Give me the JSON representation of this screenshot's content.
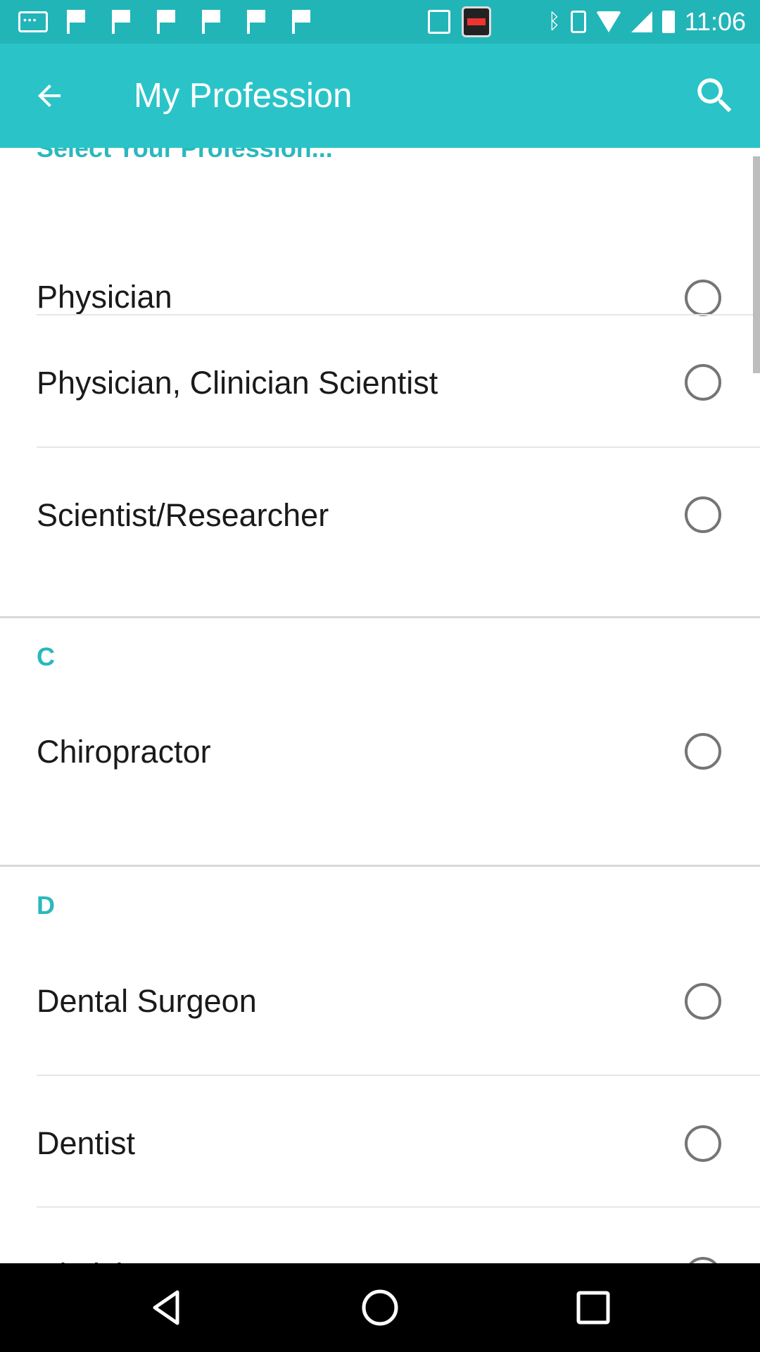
{
  "status_bar": {
    "time": "11:06",
    "icons": [
      "message-icon",
      "flag-icon",
      "flag-icon",
      "flag-icon",
      "flag-icon",
      "flag-icon",
      "flag-icon",
      "document-icon",
      "police-app-icon",
      "bluetooth-icon",
      "vibrate-icon",
      "wifi-icon",
      "signal-icon",
      "battery-icon"
    ]
  },
  "app_bar": {
    "title": "My Profession",
    "back_icon": "arrow-back-icon",
    "search_icon": "search-icon",
    "color": "#2ac4c8"
  },
  "list": {
    "top_header": "Select Your Profession...",
    "groups": [
      {
        "items": [
          {
            "label": "Physician",
            "selected": false
          },
          {
            "label": "Physician, Clinician Scientist",
            "selected": false
          },
          {
            "label": "Scientist/Researcher",
            "selected": false
          }
        ]
      },
      {
        "header": "C",
        "items": [
          {
            "label": "Chiropractor",
            "selected": false
          }
        ]
      },
      {
        "header": "D",
        "items": [
          {
            "label": "Dental Surgeon",
            "selected": false
          },
          {
            "label": "Dentist",
            "selected": false
          },
          {
            "label": "Dietician",
            "selected": false
          }
        ]
      }
    ],
    "accent_color": "#2ab8bd"
  },
  "nav_bar": {
    "icons": [
      "back-triangle-icon",
      "home-circle-icon",
      "recents-square-icon"
    ]
  }
}
